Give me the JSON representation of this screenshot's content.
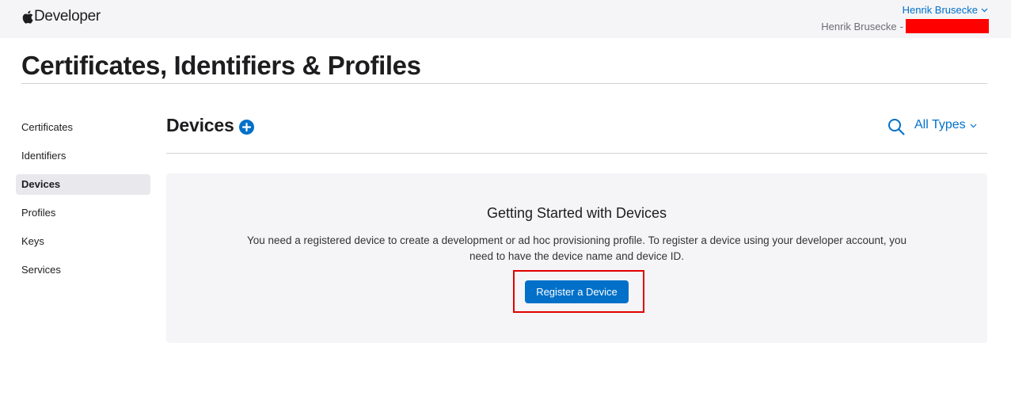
{
  "header": {
    "brand_text": "Developer",
    "user_name": "Henrik Brusecke",
    "team_name": "Henrik Brusecke",
    "team_separator": "-",
    "accent_color": "#0070c9"
  },
  "page": {
    "title": "Certificates, Identifiers & Profiles"
  },
  "sidebar": {
    "items": [
      {
        "label": "Certificates",
        "active": false
      },
      {
        "label": "Identifiers",
        "active": false
      },
      {
        "label": "Devices",
        "active": true
      },
      {
        "label": "Profiles",
        "active": false
      },
      {
        "label": "Keys",
        "active": false
      },
      {
        "label": "Services",
        "active": false
      }
    ]
  },
  "section": {
    "title": "Devices",
    "filter_label": "All Types"
  },
  "empty_state": {
    "title": "Getting Started with Devices",
    "text": "You need a registered device to create a development or ad hoc provisioning profile. To register a device using your developer account, you need to have the device name and device ID.",
    "button_label": "Register a Device"
  }
}
